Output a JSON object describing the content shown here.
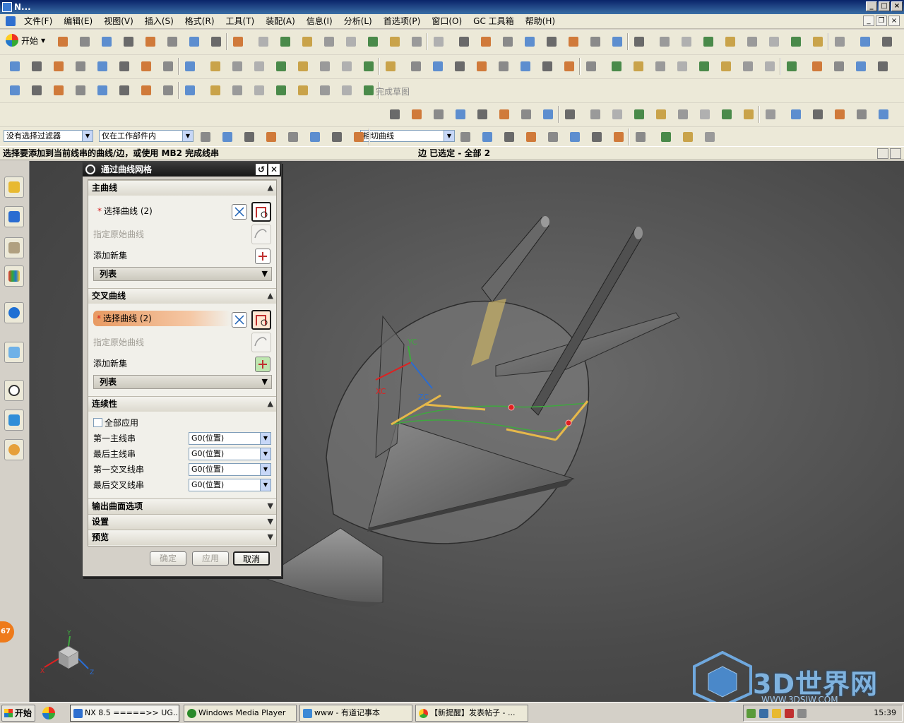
{
  "window": {
    "title": "N..."
  },
  "menu": [
    "文件(F)",
    "编辑(E)",
    "视图(V)",
    "插入(S)",
    "格式(R)",
    "工具(T)",
    "装配(A)",
    "信息(I)",
    "分析(L)",
    "首选项(P)",
    "窗口(O)",
    "GC 工具箱",
    "帮助(H)"
  ],
  "toolbar": {
    "start_label": "开始",
    "sketch_finish_label": "完成草图"
  },
  "selection_bar": {
    "filter": "没有选择过滤器",
    "scope": "仅在工作部件内",
    "curve_rule": "相切曲线"
  },
  "status": {
    "prompt": "选择要添加到当前线串的曲线/边，或使用 MB2 完成线串",
    "selected": "边 已选定 - 全部 2"
  },
  "dialog": {
    "title": "通过曲线网格",
    "primary": {
      "header": "主曲线",
      "select": "选择曲线 (2)",
      "origin": "指定原始曲线",
      "add": "添加新集",
      "list": "列表"
    },
    "cross": {
      "header": "交叉曲线",
      "select": "选择曲线 (2)",
      "origin": "指定原始曲线",
      "add": "添加新集",
      "list": "列表"
    },
    "continuity": {
      "header": "连续性",
      "apply_all": "全部应用",
      "rows": [
        {
          "label": "第一主线串",
          "value": "G0(位置)"
        },
        {
          "label": "最后主线串",
          "value": "G0(位置)"
        },
        {
          "label": "第一交叉线串",
          "value": "G0(位置)"
        },
        {
          "label": "最后交叉线串",
          "value": "G0(位置)"
        }
      ]
    },
    "output": "输出曲面选项",
    "settings": "设置",
    "preview": "预览",
    "ok": "确定",
    "apply": "应用",
    "cancel": "取消"
  },
  "viewport": {
    "axis_yc": "YC",
    "axis_xc": "XC",
    "axis_zc": "ZC",
    "triad_y": "Y",
    "triad_x": "X",
    "triad_z": "Z"
  },
  "sidebar": {
    "badge": "67"
  },
  "watermark": {
    "text": "3D世界网",
    "url": "WWW.3DSJW.COM"
  },
  "taskbar": {
    "start": "开始",
    "tasks": [
      "NX 8.5 =====>> UG...",
      "Windows Media Player",
      "www - 有道记事本",
      "【新提醒】发表帖子 - ..."
    ],
    "clock": "15:39"
  },
  "colors": {
    "accent_orange": "#e89a62",
    "curve_green": "#3fa83f",
    "vector_gold": "#e6b84a",
    "point_red": "#e02020",
    "title_dark": "#1a1a1a"
  }
}
